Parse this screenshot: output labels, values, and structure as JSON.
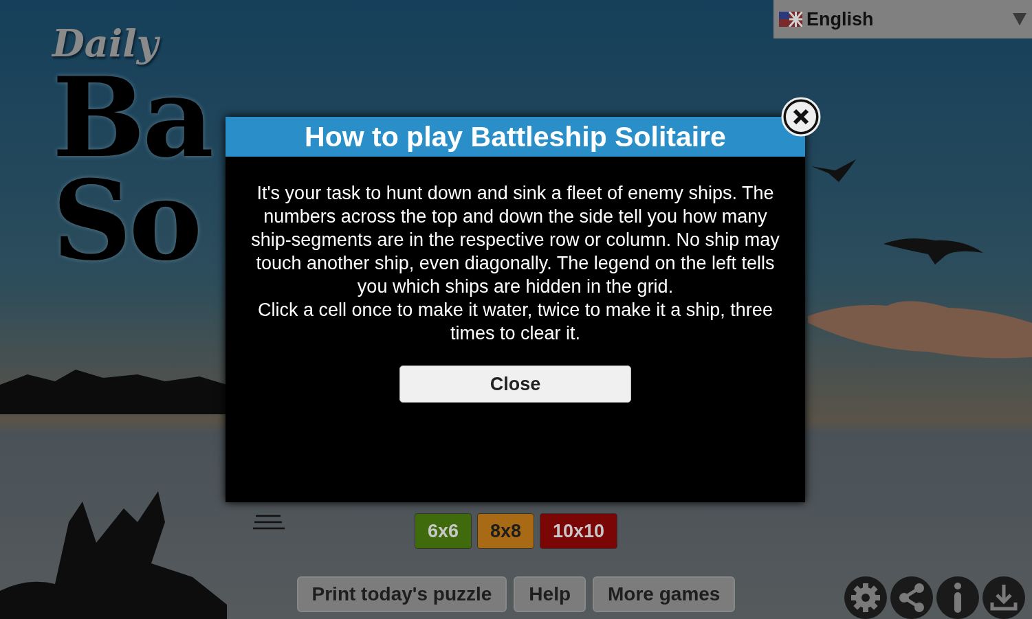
{
  "title": {
    "line_1": "Daily",
    "line_2": "Ba",
    "line_3": "So"
  },
  "language": {
    "value": "English"
  },
  "sizes": [
    {
      "label": "6x6",
      "color": "#3f6b0c"
    },
    {
      "label": "8x8",
      "color": "#a86a14"
    },
    {
      "label": "10x10",
      "color": "#7a0606"
    }
  ],
  "buttons": [
    "Print today's puzzle",
    "Help",
    "More games"
  ],
  "dialog": {
    "title": "How to play Battleship Solitaire",
    "paragraphs": [
      "It's your task to hunt down and sink a fleet of enemy ships. The numbers across the top and down the side tell you how many ship-segments are in the respective row or column. No ship may touch another ship, even diagonally. The legend on the left tells you which ships are hidden in the grid.",
      "Click a cell once to make it water, twice to make it a ship, three times to clear it."
    ],
    "button": "Close"
  }
}
